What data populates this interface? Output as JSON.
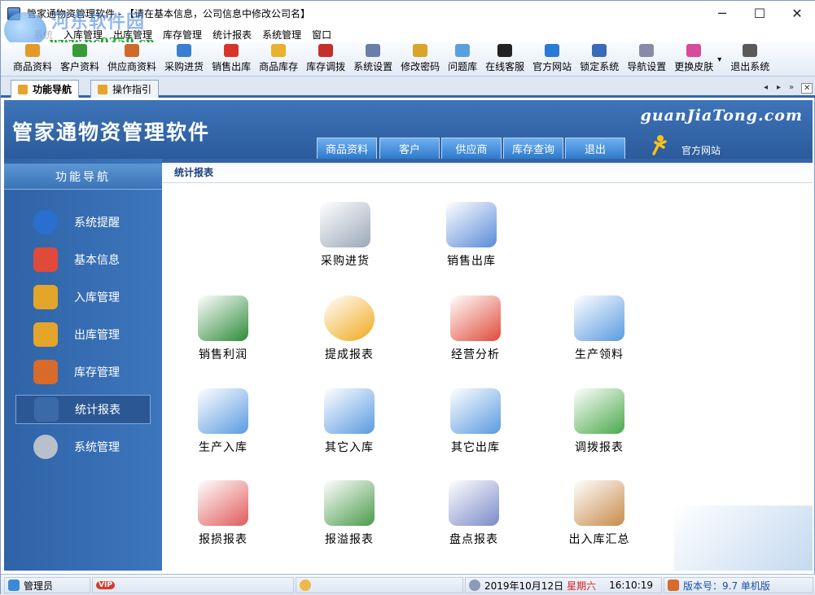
{
  "window": {
    "title": "管家通物资管理软件 - 【请在基本信息，公司信息中修改公司名】",
    "watermark_line1": "河东软件园",
    "watermark_line2": "www.pc0359.cn",
    "minimize_glyph": "─",
    "maximize_glyph": "☐",
    "close_glyph": "✕"
  },
  "menu": [
    "系统",
    "入库管理",
    "出库管理",
    "库存管理",
    "统计报表",
    "系统管理",
    "窗口"
  ],
  "toolbar": [
    {
      "label": "商品资料",
      "icon": "goods-icon",
      "color": "#e39a2a"
    },
    {
      "label": "客户资料",
      "icon": "customers-icon",
      "color": "#3a9a3a"
    },
    {
      "label": "供应商资料",
      "icon": "suppliers-icon",
      "color": "#d06a2a"
    },
    {
      "label": "采购进货",
      "icon": "purchase-icon",
      "color": "#3b7fd0"
    },
    {
      "label": "销售出库",
      "icon": "sales-icon",
      "color": "#d8352a"
    },
    {
      "label": "商品库存",
      "icon": "stock-icon",
      "color": "#e8b12e"
    },
    {
      "label": "库存调拨",
      "icon": "transfer-icon",
      "color": "#c4302a"
    },
    {
      "label": "系统设置",
      "icon": "settings-icon",
      "color": "#6a7fa8"
    },
    {
      "label": "修改密码",
      "icon": "password-icon",
      "color": "#d8a52a"
    },
    {
      "label": "问题库",
      "icon": "faq-icon",
      "color": "#5aa0e0"
    },
    {
      "label": "在线客服",
      "icon": "qq-icon",
      "color": "#222222"
    },
    {
      "label": "官方网站",
      "icon": "ie-icon",
      "color": "#2a7ad8"
    },
    {
      "label": "锁定系统",
      "icon": "lock-icon",
      "color": "#3a6ab8"
    },
    {
      "label": "导航设置",
      "icon": "nav-settings-icon",
      "color": "#8a8aa8"
    },
    {
      "label": "更换皮肤",
      "icon": "skin-icon",
      "color": "#d84a9a"
    },
    {
      "label": "退出系统",
      "icon": "exit-icon",
      "color": "#5a5a5a"
    }
  ],
  "tabs": [
    {
      "label": "功能导航",
      "active": true
    },
    {
      "label": "操作指引",
      "active": false
    }
  ],
  "tab_controls": [
    "◂",
    "▸",
    "✕"
  ],
  "banner": {
    "app_title": "管家通物资管理软件",
    "site_text": "guanJiaTong.com",
    "official_site": "官方网站",
    "nav_buttons": [
      "商品资料",
      "客户",
      "供应商",
      "库存查询",
      "退出"
    ]
  },
  "sidebar": {
    "header": "功能导航",
    "items": [
      {
        "label": "系统提醒",
        "icon": "info-icon",
        "color": "#2a6fd0"
      },
      {
        "label": "基本信息",
        "icon": "cubes-icon",
        "color": "#e04a3a"
      },
      {
        "label": "入库管理",
        "icon": "inbound-box-icon",
        "color": "#e3a52a"
      },
      {
        "label": "出库管理",
        "icon": "outbound-box-icon",
        "color": "#e3a52a"
      },
      {
        "label": "库存管理",
        "icon": "warehouse-icon",
        "color": "#d86a2a"
      },
      {
        "label": "统计报表",
        "icon": "chart-icon",
        "color": "#3a6aa8",
        "selected": true
      },
      {
        "label": "系统管理",
        "icon": "gears-icon",
        "color": "#b8c0cc"
      }
    ]
  },
  "content": {
    "breadcrumb": "统计报表",
    "items": [
      {
        "label": "采购进货",
        "icon": "cart-icon",
        "color": "#9aa8b8"
      },
      {
        "label": "销售出库",
        "icon": "truck-icon",
        "color": "#5a8ad8"
      },
      {
        "label": "销售利润",
        "icon": "money-chart-icon",
        "color": "#2e8a3a"
      },
      {
        "label": "提成报表",
        "icon": "dollar-face-icon",
        "color": "#f0a818"
      },
      {
        "label": "经营分析",
        "icon": "bar-report-icon",
        "color": "#e04a3a"
      },
      {
        "label": "生产领料",
        "icon": "house-out-icon",
        "color": "#5a9ae0"
      },
      {
        "label": "生产入库",
        "icon": "house-in-icon",
        "color": "#5a9ae0"
      },
      {
        "label": "其它入库",
        "icon": "house-in2-icon",
        "color": "#5a9ae0"
      },
      {
        "label": "其它出库",
        "icon": "house-out2-icon",
        "color": "#5a9ae0"
      },
      {
        "label": "调拨报表",
        "icon": "transfer-houses-icon",
        "color": "#4aa84a"
      },
      {
        "label": "报损报表",
        "icon": "damage-icon",
        "color": "#e05a5a"
      },
      {
        "label": "报溢报表",
        "icon": "overflow-icon",
        "color": "#4a9a4a"
      },
      {
        "label": "盘点报表",
        "icon": "inventory-check-icon",
        "color": "#7a8ac8"
      },
      {
        "label": "出入库汇总",
        "icon": "summary-boxes-icon",
        "color": "#c88a4a"
      }
    ]
  },
  "status": {
    "user": "管理员",
    "vip": "VIP",
    "date": "2019年10月12日",
    "weekday": "星期六",
    "time": "16:10:19",
    "version": "版本号：9.7 单机版"
  }
}
